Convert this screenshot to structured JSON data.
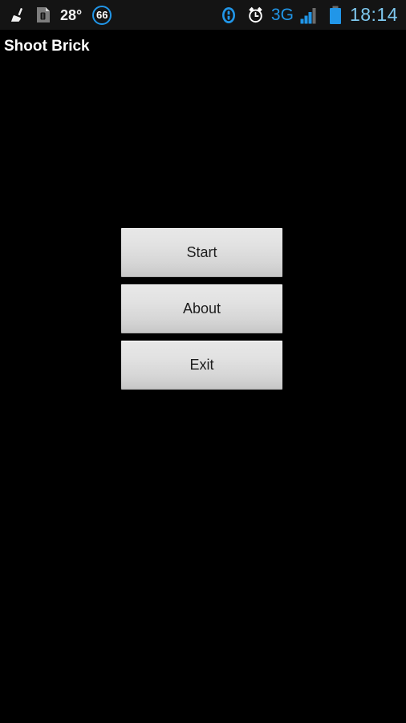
{
  "status_bar": {
    "background": "#141414",
    "left_icons": [
      {
        "name": "broom-cleaner-icon",
        "color": "#f2f2f2"
      },
      {
        "name": "sim-card-icon",
        "color": "#8a8a8a"
      }
    ],
    "temperature": "28°",
    "badge_value": "66",
    "badge_color": "#2196e8",
    "right_icons": [
      {
        "name": "vibrate-mode-icon",
        "color": "#2196e8"
      },
      {
        "name": "alarm-clock-icon",
        "color": "#ffffff"
      },
      {
        "name": "signal-bars-icon",
        "color": "#2196e8"
      },
      {
        "name": "battery-icon",
        "color": "#2196e8"
      }
    ],
    "network_type": "3G",
    "network_color": "#2196e8",
    "clock": "18:14",
    "clock_color": "#7ec8ef"
  },
  "title_bar": {
    "title": "Shoot Brick",
    "background": "#000000",
    "text_color": "#ffffff"
  },
  "main": {
    "background": "#000000",
    "buttons": [
      {
        "label": "Start",
        "name": "start-button"
      },
      {
        "label": "About",
        "name": "about-button"
      },
      {
        "label": "Exit",
        "name": "exit-button"
      }
    ]
  }
}
